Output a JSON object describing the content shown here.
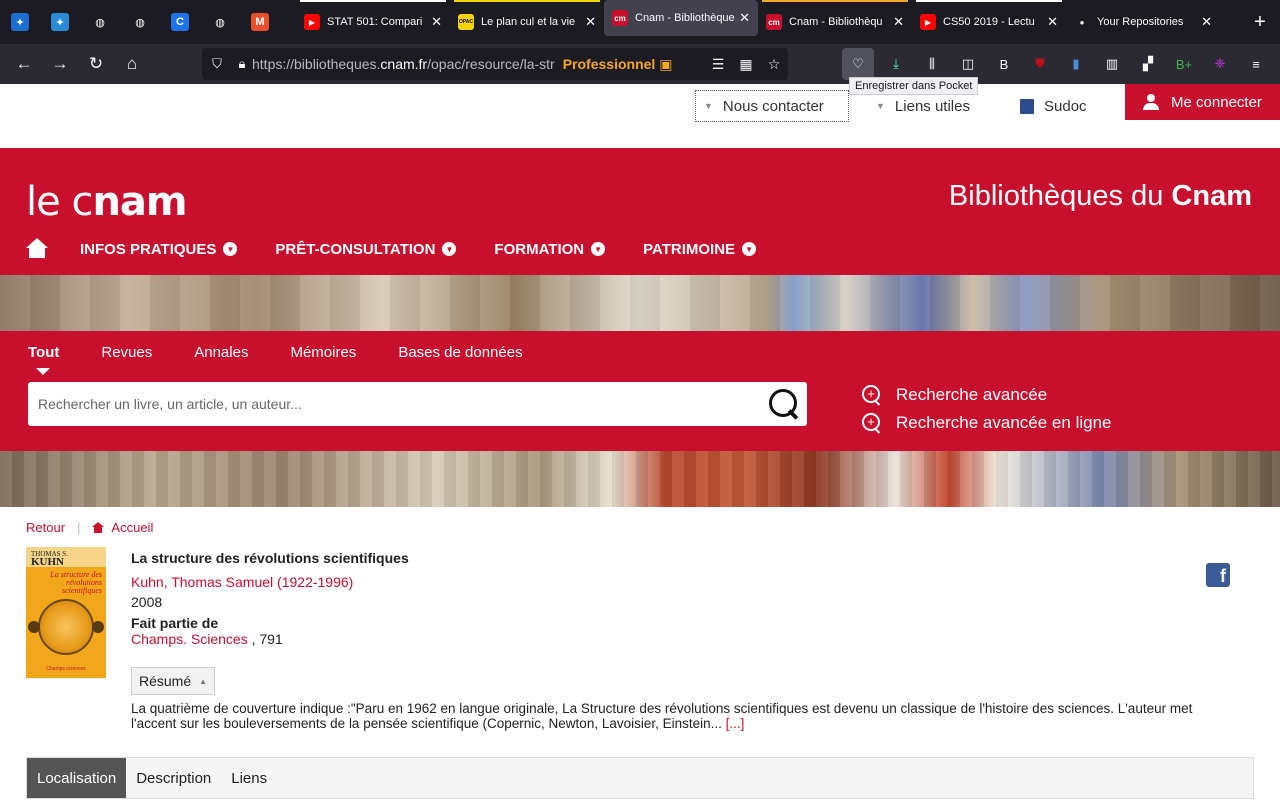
{
  "browser": {
    "pinned_tabs": [
      {
        "name": "pinned-tab-1",
        "glyph": "✦",
        "color": "#1c6fd1"
      },
      {
        "name": "pinned-tab-2",
        "glyph": "✦",
        "color": "#2a8bd4"
      },
      {
        "name": "pinned-tab-3",
        "glyph": "◍",
        "color": ""
      },
      {
        "name": "pinned-tab-4",
        "glyph": "◍",
        "color": ""
      },
      {
        "name": "pinned-tab-5",
        "glyph": "C",
        "color": "#1e73e8"
      },
      {
        "name": "pinned-tab-6",
        "glyph": "◍",
        "color": ""
      },
      {
        "name": "pinned-tab-7",
        "glyph": "M",
        "color": "#e94f2c"
      }
    ],
    "tabs": [
      {
        "title": "STAT 501: Compari",
        "icon": "youtube-icon",
        "icon_color": "#ff0000",
        "icon_text": "▶",
        "line": "#ffffff",
        "active": false
      },
      {
        "title": "Le plan cul et la vie",
        "icon": "opac-icon",
        "icon_color": "#f4d400",
        "icon_text": "OPAC",
        "line": "#f4d400",
        "active": false
      },
      {
        "title": "Cnam - Bibliothèque",
        "icon": "cnam-icon",
        "icon_color": "#c8102e",
        "icon_text": "cm",
        "line": "",
        "active": true
      },
      {
        "title": "Cnam - Bibliothèqu",
        "icon": "cnam-icon",
        "icon_color": "#c8102e",
        "icon_text": "cm",
        "line": "#f5a623",
        "active": false
      },
      {
        "title": "CS50 2019 - Lectu",
        "icon": "youtube-icon",
        "icon_color": "#ff0000",
        "icon_text": "▶",
        "line": "#ffffff",
        "active": false
      },
      {
        "title": "Your Repositories",
        "icon": "github-icon",
        "icon_color": "#1c1b22",
        "icon_text": "●",
        "line": "",
        "active": false
      }
    ],
    "url_prefix": "https://bibliotheques.",
    "url_domain": "cnam.fr",
    "url_rest": "/opac/resource/la-str",
    "container_label": "Professionnel",
    "tooltip": "Enregistrer dans Pocket",
    "toolbar_icons": [
      "pocket-icon",
      "download-icon",
      "library-icon",
      "sidebar-icon",
      "b-extension-icon",
      "ublock-icon",
      "bookmark-extension-icon",
      "bar-extension-icon",
      "grid-extension-icon",
      "bplus-extension-icon",
      "purple-extension-icon",
      "menu-icon"
    ]
  },
  "utility": {
    "contact": "Nous contacter",
    "liens": "Liens utiles",
    "sudoc": "Sudoc",
    "login": "Me connecter"
  },
  "header": {
    "logo_light": "le c",
    "logo_bold": "nam",
    "title_light": "Bibliothèques du",
    "title_bold": "Cnam",
    "nav": [
      "INFOS PRATIQUES",
      "PRÊT-CONSULTATION",
      "FORMATION",
      "PATRIMOINE"
    ]
  },
  "search": {
    "tabs": [
      "Tout",
      "Revues",
      "Annales",
      "Mémoires",
      "Bases de données"
    ],
    "active_tab": "Tout",
    "placeholder": "Rechercher un livre, un article, un auteur...",
    "advanced": "Recherche avancée",
    "advanced_online": "Recherche avancée en ligne"
  },
  "breadcrumb": {
    "back": "Retour",
    "home": "Accueil"
  },
  "record": {
    "cover_author_small": "THOMAS S.",
    "cover_author": "KUHN",
    "cover_title": "La structure des révolutions scientifiques",
    "cover_publisher": "Champs sciences",
    "title": "La structure des révolutions scientifiques",
    "author": "Kuhn, Thomas Samuel (1922-1996)",
    "year": "2008",
    "part_of_label": "Fait partie de",
    "series": "Champs. Sciences",
    "series_number": " , 791",
    "resume_label": "Résumé",
    "abstract": "La quatrième de couverture indique :\"Paru en 1962 en langue originale, La Structure des révolutions scientifiques est devenu un classique de l'histoire des sciences. L'auteur met l'accent sur les bouleversements de la pensée scientifique (Copernic, Newton, Lavoisier, Einstein...",
    "more": "[...]"
  },
  "detail_tabs": [
    "Localisation",
    "Description",
    "Liens"
  ],
  "colors": {
    "brand_red": "#c8102e"
  }
}
